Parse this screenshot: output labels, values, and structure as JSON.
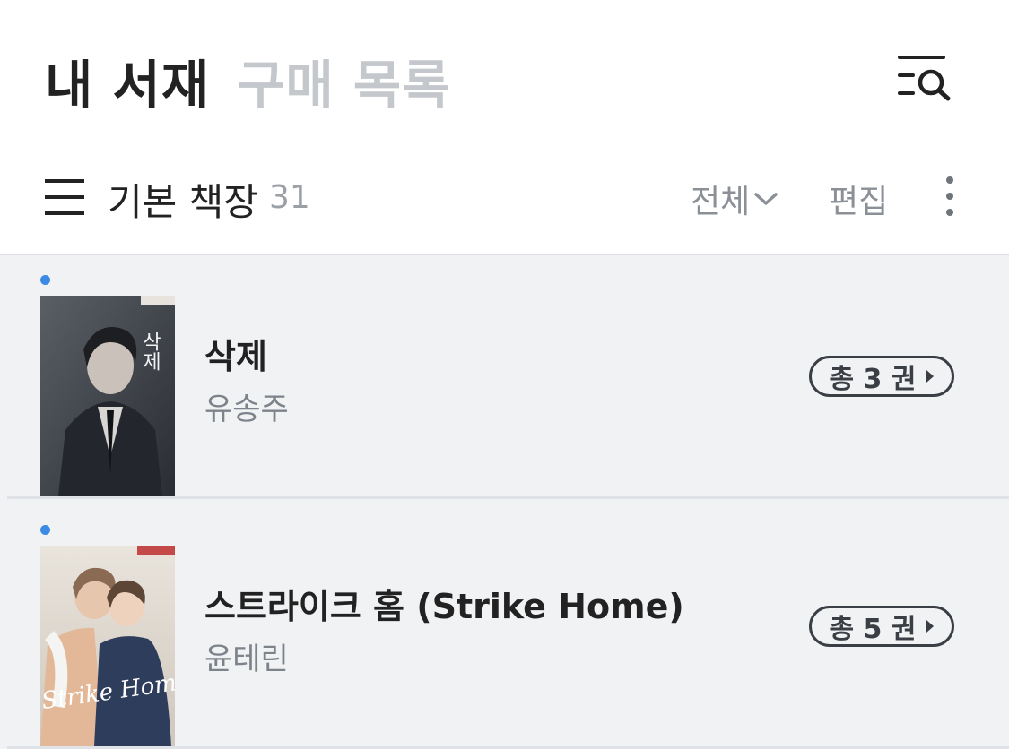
{
  "header": {
    "tab_active": "내 서재",
    "tab_inactive": "구매 목록",
    "search_icon": "list-search-icon"
  },
  "shelf": {
    "title": "기본 책장",
    "count": "31",
    "filter_label": "전체",
    "edit_label": "편집"
  },
  "books": [
    {
      "title": "삭제",
      "author": "유송주",
      "volumes": "총 3 권",
      "is_new": true,
      "cover_text": "삭제"
    },
    {
      "title": "스트라이크 홈 (Strike Home)",
      "author": "윤테린",
      "volumes": "총 5 권",
      "is_new": true,
      "cover_text": "Strike Home"
    }
  ],
  "colors": {
    "accent_dot": "#3d8ae6",
    "list_bg": "#f1f2f4",
    "inactive_text": "#c4c8cc"
  }
}
